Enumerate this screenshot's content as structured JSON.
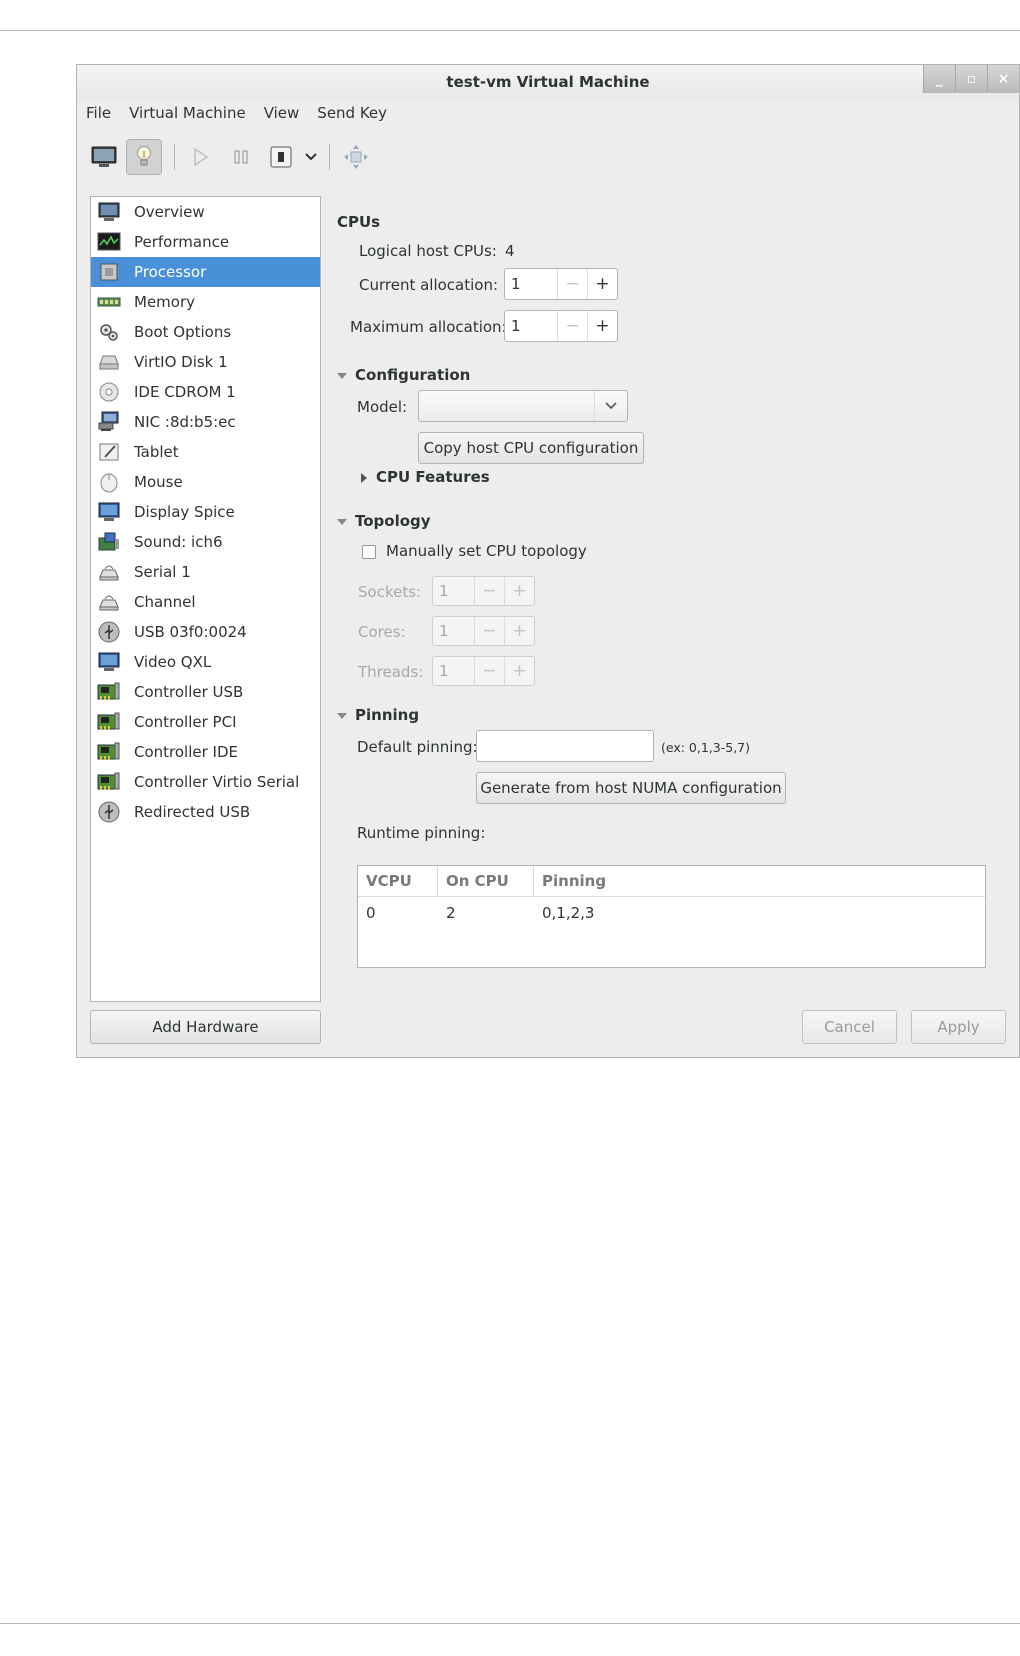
{
  "window": {
    "title": "test-vm Virtual Machine",
    "controls": [
      "_",
      "▫",
      "×"
    ]
  },
  "menubar": [
    "File",
    "Virtual Machine",
    "View",
    "Send Key"
  ],
  "toolbar": {
    "buttons": [
      "console-icon",
      "lightbulb-icon",
      "run-icon",
      "pause-icon",
      "shutdown-icon",
      "shutdown-dropdown-icon",
      "fullscreen-icon"
    ]
  },
  "sidebar": {
    "items": [
      {
        "label": "Overview",
        "icon": "monitor-icon"
      },
      {
        "label": "Performance",
        "icon": "performance-graph-icon"
      },
      {
        "label": "Processor",
        "icon": "processor-chip-icon",
        "selected": true
      },
      {
        "label": "Memory",
        "icon": "memory-icon"
      },
      {
        "label": "Boot Options",
        "icon": "gears-icon"
      },
      {
        "label": "VirtIO Disk 1",
        "icon": "disk-icon"
      },
      {
        "label": "IDE CDROM 1",
        "icon": "cdrom-icon"
      },
      {
        "label": "NIC :8d:b5:ec",
        "icon": "network-icon"
      },
      {
        "label": "Tablet",
        "icon": "tablet-icon"
      },
      {
        "label": "Mouse",
        "icon": "mouse-icon"
      },
      {
        "label": "Display Spice",
        "icon": "display-icon"
      },
      {
        "label": "Sound: ich6",
        "icon": "sound-card-icon"
      },
      {
        "label": "Serial 1",
        "icon": "serial-icon"
      },
      {
        "label": "Channel",
        "icon": "channel-icon"
      },
      {
        "label": "USB 03f0:0024",
        "icon": "usb-icon"
      },
      {
        "label": "Video QXL",
        "icon": "video-icon"
      },
      {
        "label": "Controller USB",
        "icon": "controller-card-icon"
      },
      {
        "label": "Controller PCI",
        "icon": "controller-card-icon"
      },
      {
        "label": "Controller IDE",
        "icon": "controller-card-icon"
      },
      {
        "label": "Controller Virtio Serial",
        "icon": "controller-card-icon"
      },
      {
        "label": "Redirected USB",
        "icon": "usb-icon"
      }
    ],
    "add_hardware": "Add Hardware"
  },
  "cpus": {
    "heading": "CPUs",
    "logical_label": "Logical host CPUs:",
    "logical_value": "4",
    "current_label": "Current allocation:",
    "current_value": "1",
    "maximum_label": "Maximum allocation:",
    "maximum_value": "1",
    "minus": "−",
    "plus": "+"
  },
  "configuration": {
    "heading": "Configuration",
    "model_label": "Model:",
    "model_value": "",
    "copy_button": "Copy host CPU configuration",
    "cpu_features": "CPU Features"
  },
  "topology": {
    "heading": "Topology",
    "manual_checkbox": "Manually set CPU topology",
    "manual_checked": false,
    "sockets_label": "Sockets:",
    "sockets_value": "1",
    "cores_label": "Cores:",
    "cores_value": "1",
    "threads_label": "Threads:",
    "threads_value": "1"
  },
  "pinning": {
    "heading": "Pinning",
    "default_label": "Default pinning:",
    "default_value": "",
    "example": "(ex: 0,1,3-5,7)",
    "generate_button": "Generate from host NUMA configuration",
    "runtime_label": "Runtime pinning:",
    "columns": [
      "VCPU",
      "On CPU",
      "Pinning"
    ],
    "rows": [
      [
        "0",
        "2",
        "0,1,2,3"
      ]
    ]
  },
  "footer": {
    "cancel": "Cancel",
    "apply": "Apply"
  }
}
